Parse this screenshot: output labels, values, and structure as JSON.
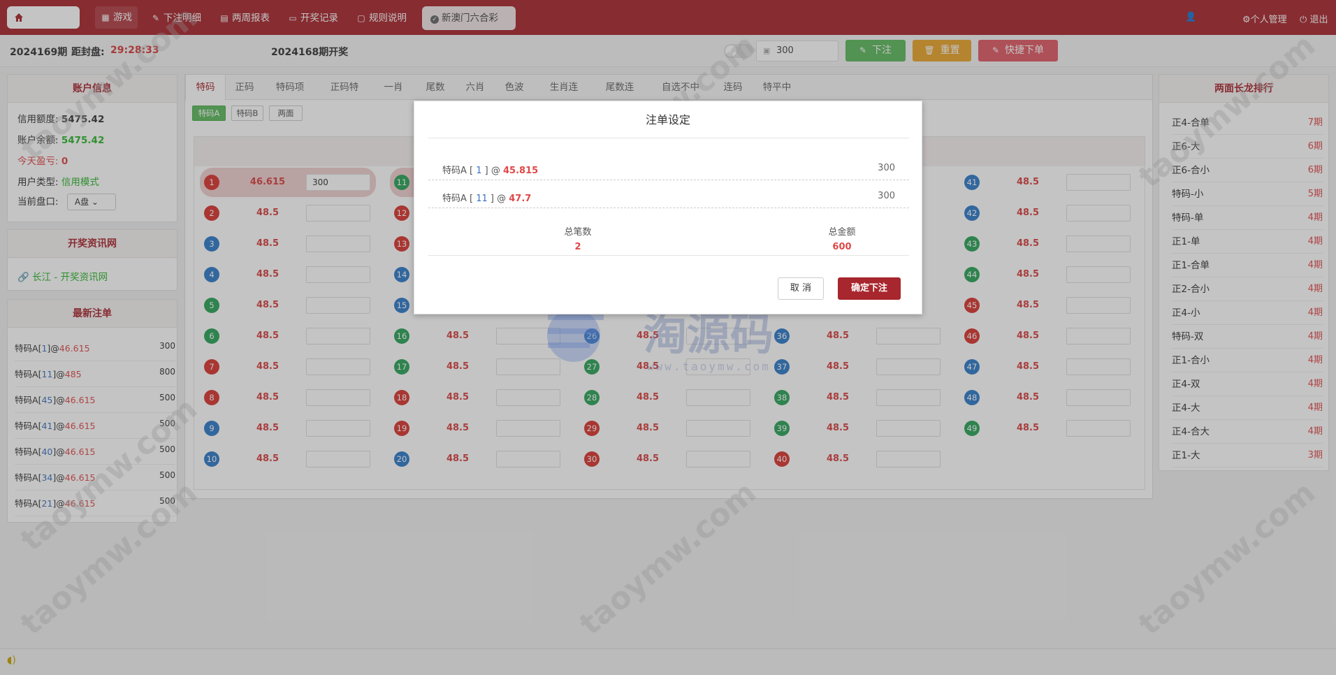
{
  "nav": {
    "items": [
      {
        "label": "游戏",
        "icon": "grid-icon"
      },
      {
        "label": "下注明细",
        "icon": "pencil-icon"
      },
      {
        "label": "两周报表",
        "icon": "calendar-icon"
      },
      {
        "label": "开奖记录",
        "icon": "monitor-icon"
      },
      {
        "label": "规则说明",
        "icon": "chat-icon"
      }
    ],
    "lottery": "新澳门六合彩",
    "personal": "个人管理",
    "logout": "退出"
  },
  "subbar": {
    "period": "2024169期",
    "countdown_label": "距封盘:",
    "countdown": "29:28:33",
    "last_draw": "2024168期开奖",
    "amount": "300",
    "bet_label": "下注",
    "reset_label": "重置",
    "quick_label": "快捷下单"
  },
  "account": {
    "title": "账户信息",
    "credit_label": "信用额度:",
    "credit": "5475.42",
    "balance_label": "账户余额:",
    "balance": "5475.42",
    "today_label": "今天盈亏:",
    "today": "0",
    "type_label": "用户类型:",
    "type": "信用模式",
    "market_label": "当前盘口:",
    "market": "A盘"
  },
  "info_site": {
    "title": "开奖资讯网",
    "link": "长江 - 开奖资讯网"
  },
  "recent": {
    "title": "最新注单",
    "items": [
      {
        "name": "特码A",
        "num": "1",
        "odds": "46.615",
        "amount": "300"
      },
      {
        "name": "特码A",
        "num": "11",
        "odds": "485",
        "amount": "800"
      },
      {
        "name": "特码A",
        "num": "45",
        "odds": "46.615",
        "amount": "500"
      },
      {
        "name": "特码A",
        "num": "41",
        "odds": "46.615",
        "amount": "500"
      },
      {
        "name": "特码A",
        "num": "40",
        "odds": "46.615",
        "amount": "500"
      },
      {
        "name": "特码A",
        "num": "34",
        "odds": "46.615",
        "amount": "500"
      },
      {
        "name": "特码A",
        "num": "21",
        "odds": "46.615",
        "amount": "500"
      }
    ]
  },
  "tabs": [
    "特码",
    "正码",
    "特码项",
    "正码特",
    "一肖",
    "尾数",
    "六肖",
    "色波",
    "生肖连",
    "尾数连",
    "自选不中",
    "连码",
    "特平中"
  ],
  "subtabs": [
    "特码A",
    "特码B",
    "两面"
  ],
  "balls": [
    {
      "n": "1",
      "c": "r",
      "odds": "46.615",
      "val": "300"
    },
    {
      "n": "2",
      "c": "r",
      "odds": "48.5",
      "val": ""
    },
    {
      "n": "3",
      "c": "b",
      "odds": "48.5",
      "val": ""
    },
    {
      "n": "4",
      "c": "b",
      "odds": "48.5",
      "val": ""
    },
    {
      "n": "5",
      "c": "g",
      "odds": "48.5",
      "val": ""
    },
    {
      "n": "6",
      "c": "g",
      "odds": "48.5",
      "val": ""
    },
    {
      "n": "7",
      "c": "r",
      "odds": "48.5",
      "val": ""
    },
    {
      "n": "8",
      "c": "r",
      "odds": "48.5",
      "val": ""
    },
    {
      "n": "9",
      "c": "b",
      "odds": "48.5",
      "val": ""
    },
    {
      "n": "10",
      "c": "b",
      "odds": "48.5",
      "val": ""
    },
    {
      "n": "11",
      "c": "g",
      "odds": "",
      "val": ""
    },
    {
      "n": "12",
      "c": "r",
      "odds": "",
      "val": ""
    },
    {
      "n": "13",
      "c": "r",
      "odds": "",
      "val": ""
    },
    {
      "n": "14",
      "c": "b",
      "odds": "",
      "val": ""
    },
    {
      "n": "15",
      "c": "b",
      "odds": "",
      "val": ""
    },
    {
      "n": "16",
      "c": "g",
      "odds": "48.5",
      "val": ""
    },
    {
      "n": "17",
      "c": "g",
      "odds": "48.5",
      "val": ""
    },
    {
      "n": "18",
      "c": "r",
      "odds": "48.5",
      "val": ""
    },
    {
      "n": "19",
      "c": "r",
      "odds": "48.5",
      "val": ""
    },
    {
      "n": "20",
      "c": "b",
      "odds": "48.5",
      "val": ""
    },
    {
      "n": "26",
      "c": "b",
      "odds": "48.5",
      "val": ""
    },
    {
      "n": "27",
      "c": "g",
      "odds": "48.5",
      "val": ""
    },
    {
      "n": "28",
      "c": "g",
      "odds": "48.5",
      "val": ""
    },
    {
      "n": "29",
      "c": "r",
      "odds": "48.5",
      "val": ""
    },
    {
      "n": "30",
      "c": "r",
      "odds": "48.5",
      "val": ""
    },
    {
      "n": "36",
      "c": "b",
      "odds": "48.5",
      "val": ""
    },
    {
      "n": "37",
      "c": "b",
      "odds": "48.5",
      "val": ""
    },
    {
      "n": "38",
      "c": "g",
      "odds": "48.5",
      "val": ""
    },
    {
      "n": "39",
      "c": "g",
      "odds": "48.5",
      "val": ""
    },
    {
      "n": "40",
      "c": "r",
      "odds": "48.5",
      "val": ""
    },
    {
      "n": "41",
      "c": "b",
      "odds": "48.5",
      "val": ""
    },
    {
      "n": "42",
      "c": "b",
      "odds": "48.5",
      "val": ""
    },
    {
      "n": "43",
      "c": "g",
      "odds": "48.5",
      "val": ""
    },
    {
      "n": "44",
      "c": "g",
      "odds": "48.5",
      "val": ""
    },
    {
      "n": "45",
      "c": "r",
      "odds": "48.5",
      "val": ""
    },
    {
      "n": "46",
      "c": "r",
      "odds": "48.5",
      "val": ""
    },
    {
      "n": "47",
      "c": "b",
      "odds": "48.5",
      "val": ""
    },
    {
      "n": "48",
      "c": "b",
      "odds": "48.5",
      "val": ""
    },
    {
      "n": "49",
      "c": "g",
      "odds": "48.5",
      "val": ""
    }
  ],
  "ranking": {
    "title": "两面长龙排行",
    "items": [
      {
        "name": "正4-合单",
        "periods": "7期"
      },
      {
        "name": "正6-大",
        "periods": "6期"
      },
      {
        "name": "正6-合小",
        "periods": "6期"
      },
      {
        "name": "特码-小",
        "periods": "5期"
      },
      {
        "name": "特码-单",
        "periods": "4期"
      },
      {
        "name": "正1-单",
        "periods": "4期"
      },
      {
        "name": "正1-合单",
        "periods": "4期"
      },
      {
        "name": "正2-合小",
        "periods": "4期"
      },
      {
        "name": "正4-小",
        "periods": "4期"
      },
      {
        "name": "特码-双",
        "periods": "4期"
      },
      {
        "name": "正1-合小",
        "periods": "4期"
      },
      {
        "name": "正4-双",
        "periods": "4期"
      },
      {
        "name": "正4-大",
        "periods": "4期"
      },
      {
        "name": "正4-合大",
        "periods": "4期"
      },
      {
        "name": "正1-大",
        "periods": "3期"
      }
    ]
  },
  "modal": {
    "title": "注单设定",
    "rows": [
      {
        "name": "特码A",
        "num": "1",
        "odds": "45.815",
        "amount": "300"
      },
      {
        "name": "特码A",
        "num": "11",
        "odds": "47.7",
        "amount": "300"
      }
    ],
    "total_count_label": "总笔数",
    "total_count": "2",
    "total_amount_label": "总金额",
    "total_amount": "600",
    "cancel_label": "取 消",
    "confirm_label": "确定下注"
  },
  "watermark": {
    "text": "taoymw.com",
    "logo_text": "淘源码",
    "logo_url": "www.taoymw.com"
  },
  "colors": {
    "brand": "#a8262d",
    "green_btn": "#5cb85c",
    "orange_btn": "#e8a42a",
    "red_btn": "#e05a64",
    "odds_red": "#d94040"
  }
}
